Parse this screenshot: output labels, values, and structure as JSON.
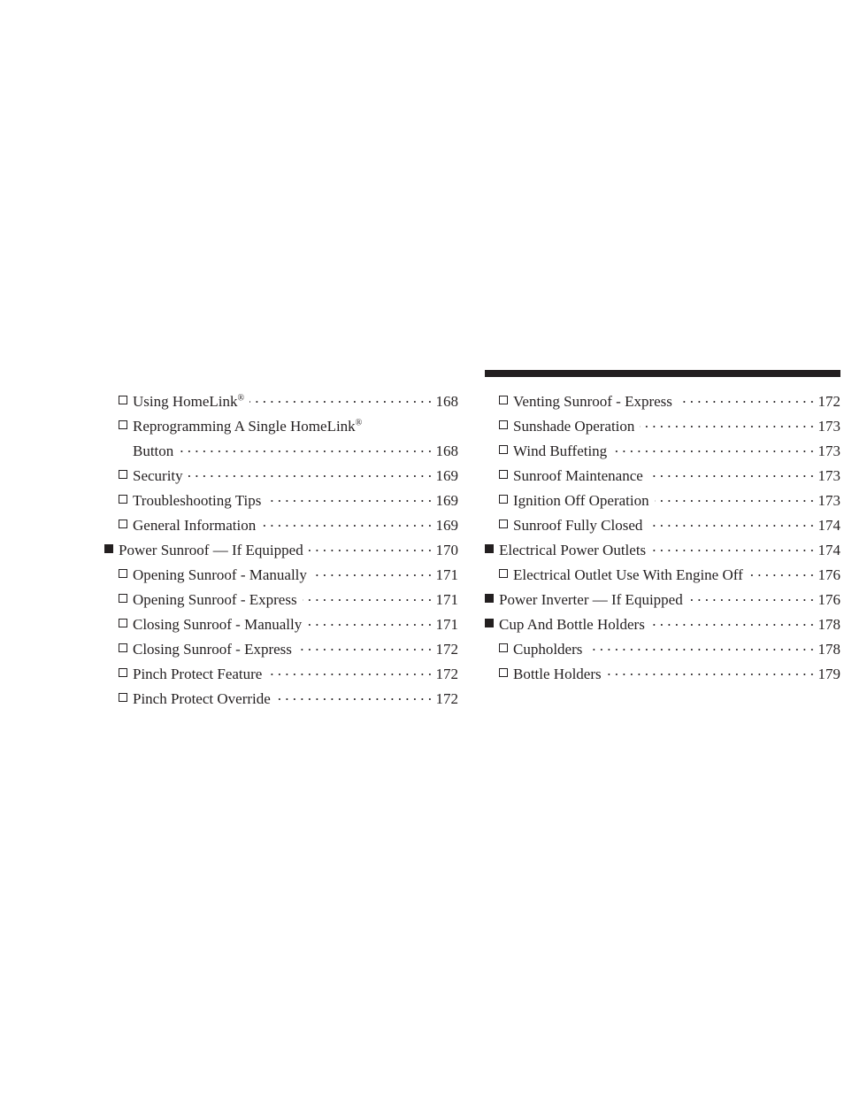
{
  "document": {
    "type": "table-of-contents",
    "background_color": "#ffffff",
    "text_color": "#231f20"
  },
  "rule": {
    "color": "#231f20"
  },
  "left_column": {
    "entries": [
      {
        "level": 2,
        "label": "Using HomeLink",
        "suffix": "®",
        "page": "168",
        "bullet": "hollow-square"
      },
      {
        "level": 2,
        "label": "Reprogramming A Single HomeLink",
        "suffix": "®",
        "label_line2": "Button",
        "page": "168",
        "bullet": "hollow-square",
        "wrapped": true
      },
      {
        "level": 2,
        "label": "Security",
        "page": "169",
        "bullet": "hollow-square"
      },
      {
        "level": 2,
        "label": "Troubleshooting Tips",
        "page": "169",
        "bullet": "hollow-square"
      },
      {
        "level": 2,
        "label": "General Information",
        "page": "169",
        "bullet": "hollow-square"
      },
      {
        "level": 1,
        "label": "Power Sunroof — If Equipped",
        "page": "170",
        "bullet": "filled-square"
      },
      {
        "level": 2,
        "label": "Opening Sunroof - Manually",
        "page": "171",
        "bullet": "hollow-square"
      },
      {
        "level": 2,
        "label": "Opening Sunroof - Express",
        "page": "171",
        "bullet": "hollow-square"
      },
      {
        "level": 2,
        "label": "Closing Sunroof - Manually",
        "page": "171",
        "bullet": "hollow-square"
      },
      {
        "level": 2,
        "label": "Closing Sunroof - Express",
        "page": "172",
        "bullet": "hollow-square"
      },
      {
        "level": 2,
        "label": "Pinch Protect Feature",
        "page": "172",
        "bullet": "hollow-square"
      },
      {
        "level": 2,
        "label": "Pinch Protect Override",
        "page": "172",
        "bullet": "hollow-square"
      }
    ]
  },
  "right_column": {
    "entries": [
      {
        "level": 2,
        "label": "Venting Sunroof - Express",
        "page": "172",
        "bullet": "hollow-square"
      },
      {
        "level": 2,
        "label": "Sunshade Operation",
        "page": "173",
        "bullet": "hollow-square"
      },
      {
        "level": 2,
        "label": "Wind Buffeting",
        "page": "173",
        "bullet": "hollow-square"
      },
      {
        "level": 2,
        "label": "Sunroof Maintenance",
        "page": "173",
        "bullet": "hollow-square"
      },
      {
        "level": 2,
        "label": "Ignition Off Operation",
        "page": "173",
        "bullet": "hollow-square"
      },
      {
        "level": 2,
        "label": "Sunroof Fully Closed",
        "page": "174",
        "bullet": "hollow-square"
      },
      {
        "level": 1,
        "label": "Electrical Power Outlets",
        "page": "174",
        "bullet": "filled-square"
      },
      {
        "level": 2,
        "label": "Electrical Outlet Use With Engine Off",
        "page": "176",
        "bullet": "hollow-square"
      },
      {
        "level": 1,
        "label": "Power Inverter — If Equipped",
        "page": "176",
        "bullet": "filled-square"
      },
      {
        "level": 1,
        "label": "Cup And Bottle Holders",
        "page": "178",
        "bullet": "filled-square"
      },
      {
        "level": 2,
        "label": "Cupholders",
        "page": "178",
        "bullet": "hollow-square"
      },
      {
        "level": 2,
        "label": "Bottle Holders",
        "page": "179",
        "bullet": "hollow-square"
      }
    ]
  }
}
